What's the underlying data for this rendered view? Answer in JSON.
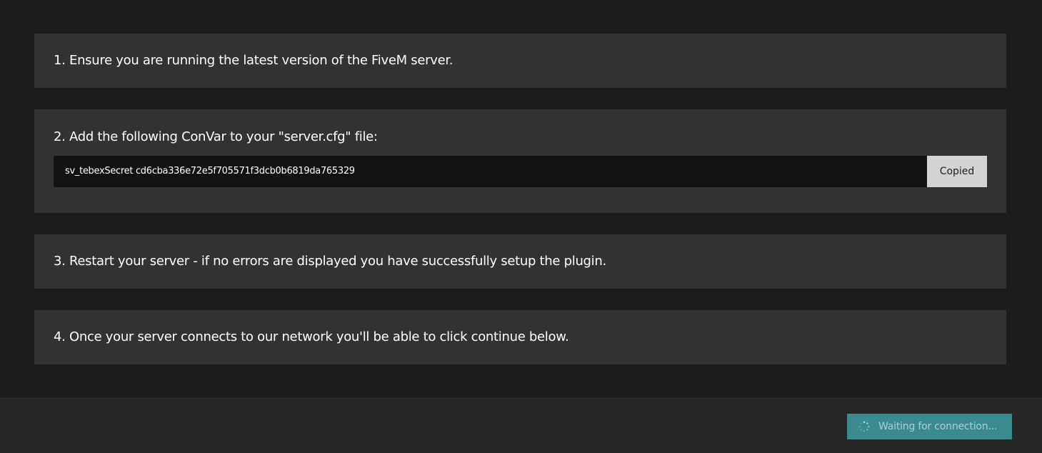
{
  "steps": [
    {
      "text": "1. Ensure you are running the latest version of the FiveM server."
    },
    {
      "text": "2. Add the following ConVar to your \"server.cfg\" file:",
      "code": "sv_tebexSecret cd6cba336e72e5f705571f3dcb0b6819da765329",
      "copy_label": "Copied"
    },
    {
      "text": "3. Restart your server - if no errors are displayed you have successfully setup the plugin."
    },
    {
      "text": "4. Once your server connects to our network you'll be able to click continue below."
    }
  ],
  "footer": {
    "waiting_label": "Waiting for connection...",
    "spinner_icon": "spinner-icon"
  },
  "colors": {
    "background": "#1c1c1c",
    "panel": "#323232",
    "accent": "#3a8a8f"
  }
}
